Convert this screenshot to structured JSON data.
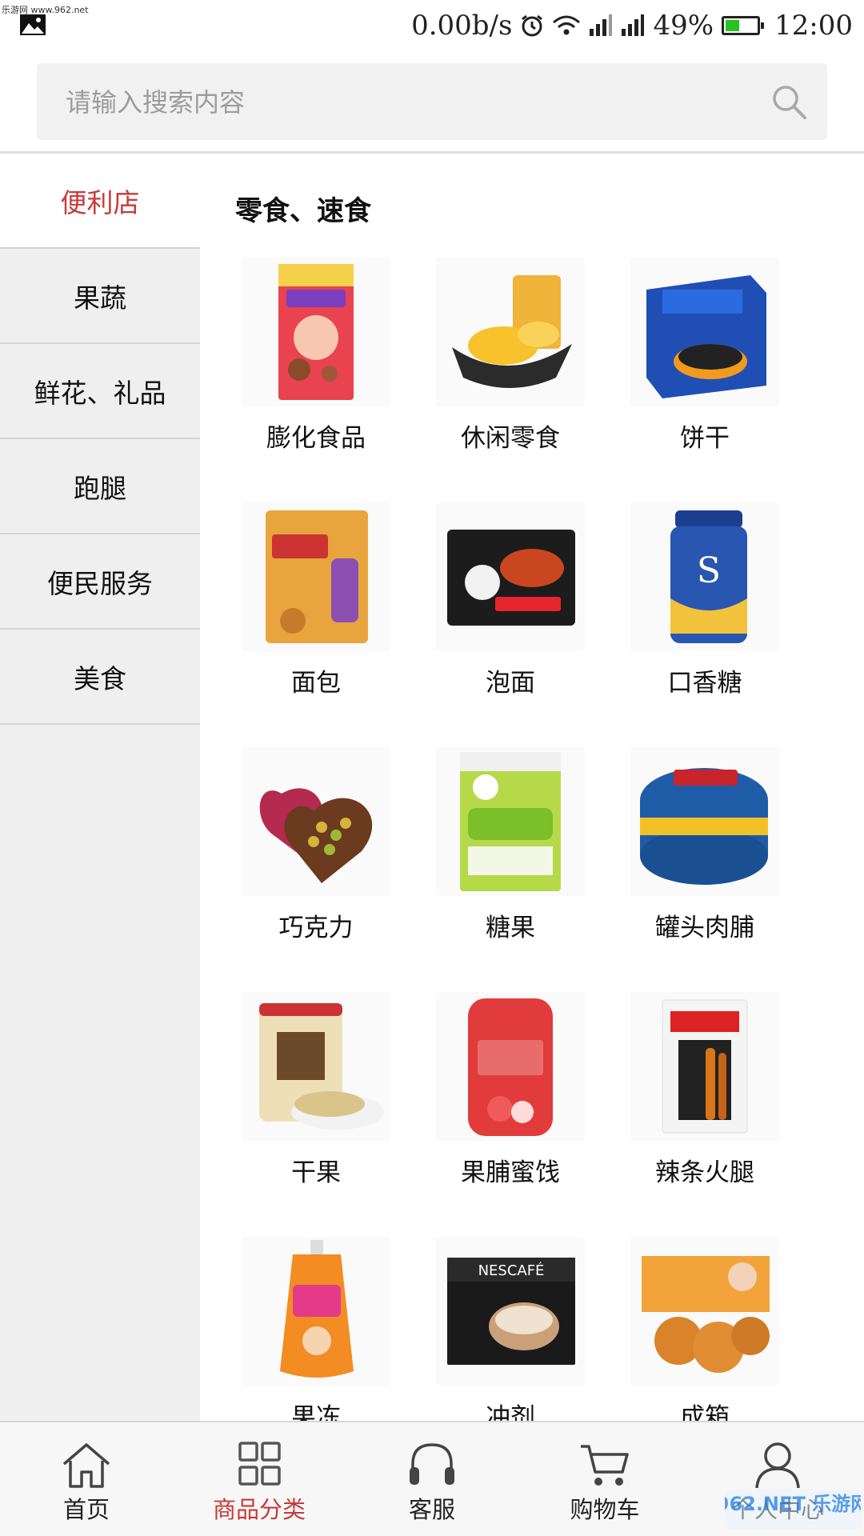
{
  "status_bar": {
    "watermark_text": "乐游网 www.962.net",
    "net_speed": "0.00b/s",
    "battery": "49%",
    "battery_level": 0.49,
    "time": "12:00",
    "icons": [
      "image-icon",
      "alarm-icon",
      "wifi-icon",
      "signal-icon",
      "signal-icon",
      "battery-icon"
    ]
  },
  "search": {
    "placeholder": "请输入搜索内容",
    "icon": "search-icon"
  },
  "sidebar": {
    "items": [
      {
        "label": "便利店",
        "active": true
      },
      {
        "label": "果蔬",
        "active": false
      },
      {
        "label": "鲜花、礼品",
        "active": false
      },
      {
        "label": "跑腿",
        "active": false
      },
      {
        "label": "便民服务",
        "active": false
      },
      {
        "label": "美食",
        "active": false
      }
    ]
  },
  "main": {
    "section_title": "零食、速食",
    "products": [
      {
        "label": "膨化食品",
        "image": "puffed-snack-bag"
      },
      {
        "label": "休闲零食",
        "image": "mango-cake"
      },
      {
        "label": "饼干",
        "image": "oreo-box"
      },
      {
        "label": "面包",
        "image": "bread-bag"
      },
      {
        "label": "泡面",
        "image": "instant-noodle-pack"
      },
      {
        "label": "口香糖",
        "image": "gum-bottle"
      },
      {
        "label": "巧克力",
        "image": "heart-chocolate-box"
      },
      {
        "label": "糖果",
        "image": "qq-candy-bag"
      },
      {
        "label": "罐头肉脯",
        "image": "tuna-can"
      },
      {
        "label": "干果",
        "image": "pistachio-jar"
      },
      {
        "label": "果脯蜜饯",
        "image": "dried-strawberry-pack"
      },
      {
        "label": "辣条火腿",
        "image": "spicy-strip-pack"
      },
      {
        "label": "果冻",
        "image": "jelly-pouch"
      },
      {
        "label": "冲剂",
        "image": "nescafe-box"
      },
      {
        "label": "成箱",
        "image": "pastry-box"
      }
    ]
  },
  "bottom_nav": {
    "items": [
      {
        "label": "首页",
        "icon": "home-icon",
        "active": false
      },
      {
        "label": "商品分类",
        "icon": "grid-icon",
        "active": true
      },
      {
        "label": "客服",
        "icon": "headphones-icon",
        "active": false
      },
      {
        "label": "购物车",
        "icon": "cart-icon",
        "active": false
      },
      {
        "label": "个人中心",
        "icon": "user-icon",
        "active": false
      }
    ]
  },
  "watermark": {
    "text": "962.NET 乐游网"
  },
  "colors": {
    "accent": "#c93a3a",
    "sidebar_bg": "#efefef",
    "search_bg": "#f1f1f1"
  }
}
